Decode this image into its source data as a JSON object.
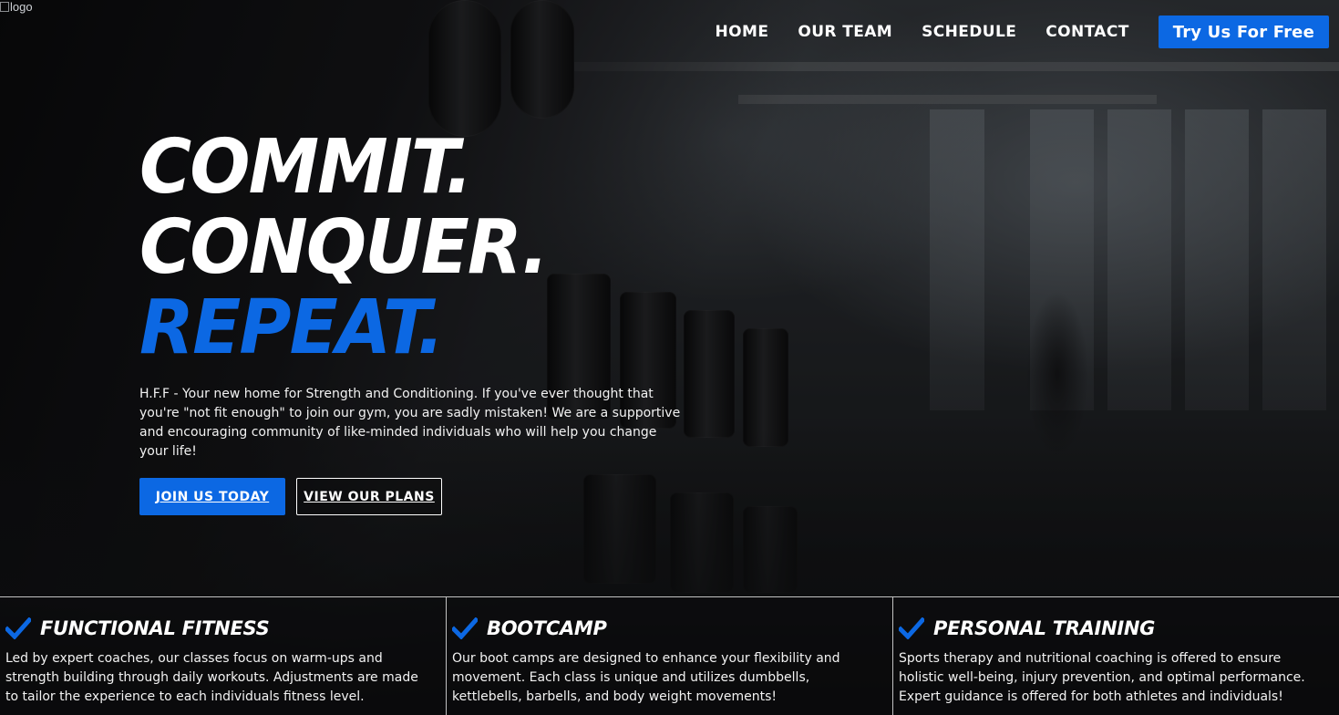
{
  "logo": {
    "alt_text": "logo"
  },
  "nav": {
    "items": [
      {
        "label": "HOME"
      },
      {
        "label": "OUR TEAM"
      },
      {
        "label": "SCHEDULE"
      },
      {
        "label": "CONTACT"
      }
    ],
    "cta_label": "Try Us For Free"
  },
  "hero": {
    "headline": [
      "COMMIT.",
      "CONQUER.",
      "REPEAT."
    ],
    "description": "H.F.F - Your new home for Strength and Conditioning. If you've ever thought that you're \"not fit enough\" to join our gym, you are sadly mistaken! We are a supportive and encouraging community of like-minded individuals who will help you change your life!",
    "primary_button": "JOIN US TODAY",
    "secondary_button": "VIEW OUR PLANS"
  },
  "features": [
    {
      "icon": "check-icon",
      "title": "FUNCTIONAL FITNESS",
      "text": "Led by expert coaches, our classes focus on warm-ups and strength building through daily workouts. Adjustments are made to tailor the experience to each individuals fitness level."
    },
    {
      "icon": "check-icon",
      "title": "BOOTCAMP",
      "text": "Our boot camps are designed to enhance your flexibility and movement. Each class is unique and utilizes dumbbells, kettlebells, barbells, and body weight movements!"
    },
    {
      "icon": "check-icon",
      "title": "PERSONAL TRAINING",
      "text": "Sports therapy and nutritional coaching is offered to ensure holistic well-being, injury prevention, and optimal performance. Expert guidance is offered for both athletes and individuals!"
    }
  ],
  "colors": {
    "accent": "#0c68e3",
    "text": "#ffffff"
  }
}
